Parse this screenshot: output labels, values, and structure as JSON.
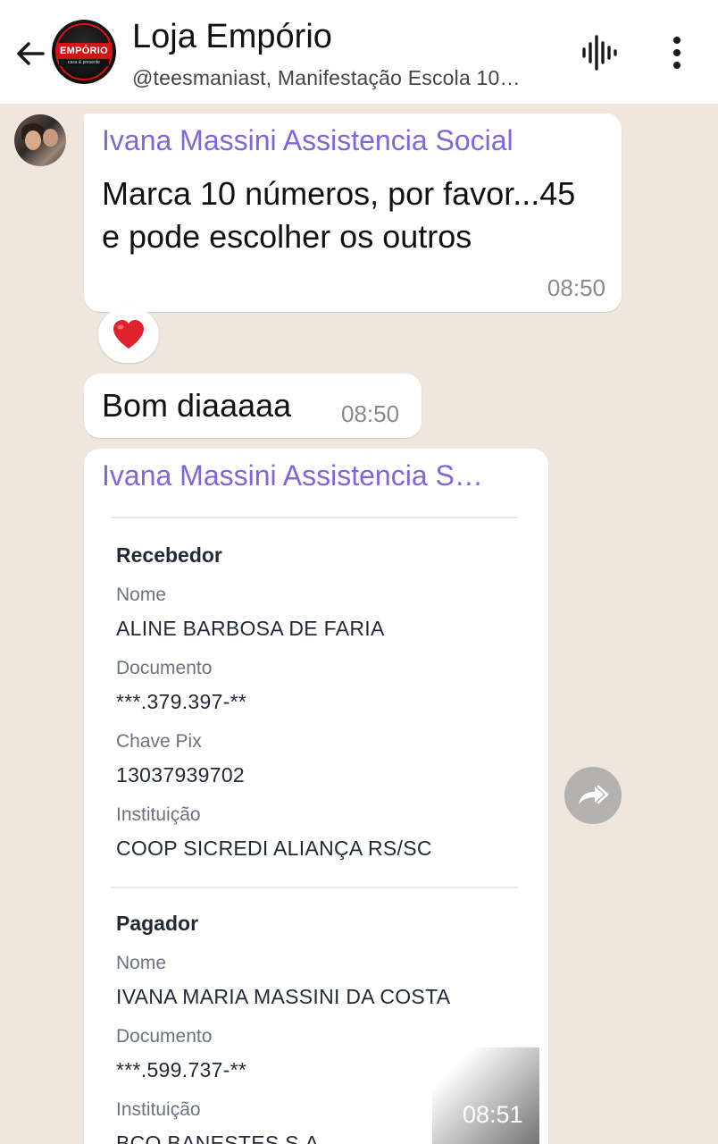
{
  "header": {
    "title": "Loja Empório",
    "subtitle": "@teesmaniast, Manifestação Escola 10…",
    "logo_text": "EMPÓRIO",
    "logo_subtext": "casa & presente"
  },
  "messages": [
    {
      "sender": "Ivana Massini Assistencia Social",
      "text": "Marca 10 números, por favor...45 e pode escolher os outros",
      "time": "08:50",
      "reaction": "❤️"
    },
    {
      "text": "Bom diaaaaa",
      "time": "08:50"
    },
    {
      "sender": "Ivana Massini Assistencia S…",
      "time": "08:51",
      "receipt": {
        "recebedor": {
          "title": "Recebedor",
          "nome_label": "Nome",
          "nome": "ALINE BARBOSA DE FARIA",
          "documento_label": "Documento",
          "documento": "***.379.397-**",
          "chave_label": "Chave Pix",
          "chave": "13037939702",
          "instituicao_label": "Instituição",
          "instituicao": "COOP SICREDI ALIANÇA RS/SC"
        },
        "pagador": {
          "title": "Pagador",
          "nome_label": "Nome",
          "nome": "IVANA MARIA MASSINI DA COSTA",
          "documento_label": "Documento",
          "documento": "***.599.737-**",
          "instituicao_label": "Instituição",
          "instituicao": "BCO BANESTES S.A."
        }
      }
    }
  ],
  "colors": {
    "sender_name": "#8166d8",
    "chat_background": "#efe7dd",
    "reaction_heart": "#e0212e"
  },
  "icons": [
    "back-arrow-icon",
    "voice-wave-icon",
    "more-vert-icon",
    "heart-icon",
    "forward-icon"
  ]
}
